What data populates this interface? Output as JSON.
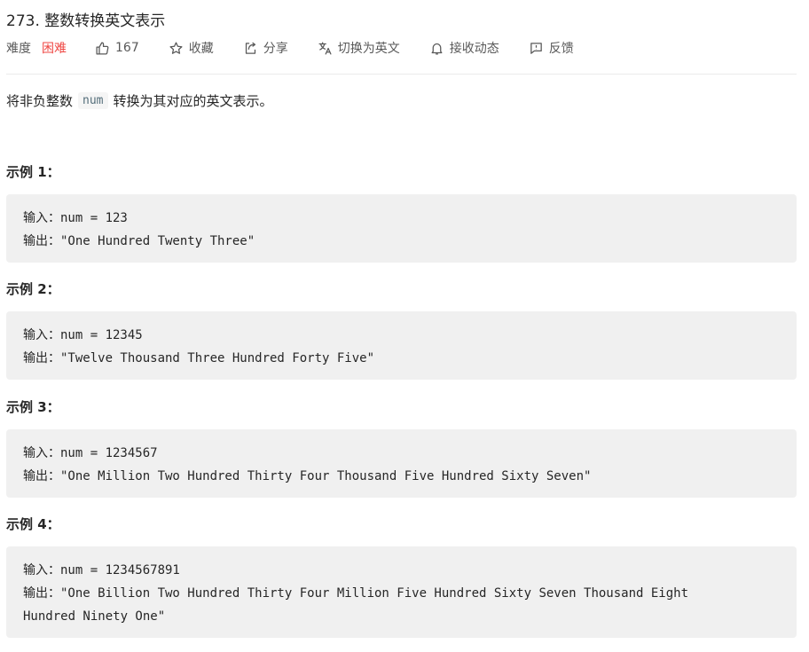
{
  "problem": {
    "title": "273. 整数转换英文表示"
  },
  "toolbar": {
    "difficulty_label": "难度",
    "difficulty_value": "困难",
    "like_count": "167",
    "favorite_label": "收藏",
    "share_label": "分享",
    "switch_lang_label": "切换为英文",
    "subscribe_label": "接收动态",
    "feedback_label": "反馈"
  },
  "description": {
    "prefix": "将非负整数",
    "code": "num",
    "suffix": "转换为其对应的英文表示。"
  },
  "examples": [
    {
      "heading": "示例 1：",
      "input_label": "输入：",
      "input_value": "num = 123",
      "output_label": "输出：",
      "output_lines": [
        "\"One Hundred Twenty Three\""
      ]
    },
    {
      "heading": "示例 2：",
      "input_label": "输入：",
      "input_value": "num = 12345",
      "output_label": "输出：",
      "output_lines": [
        "\"Twelve Thousand Three Hundred Forty Five\""
      ]
    },
    {
      "heading": "示例 3：",
      "input_label": "输入：",
      "input_value": "num = 1234567",
      "output_label": "输出：",
      "output_lines": [
        "\"One Million Two Hundred Thirty Four Thousand Five Hundred Sixty Seven\""
      ]
    },
    {
      "heading": "示例 4：",
      "input_label": "输入：",
      "input_value": "num = 1234567891",
      "output_label": "输出：",
      "output_lines": [
        "\"One Billion Two Hundred Thirty Four Million Five Hundred Sixty Seven Thousand Eight",
        "Hundred Ninety One\""
      ]
    }
  ],
  "colors": {
    "difficulty_hard": "#ef4743",
    "code_block_bg": "#f0f0f0",
    "text": "#262626",
    "muted": "#595959"
  }
}
